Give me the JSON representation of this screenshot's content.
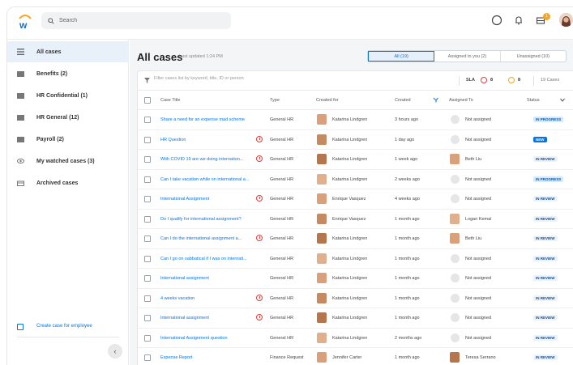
{
  "search": {
    "placeholder": "Search"
  },
  "header": {
    "notification_count": "1"
  },
  "sidebar": {
    "items": [
      {
        "label": "All cases",
        "icon": "list-icon",
        "active": true
      },
      {
        "label": "Benefits (2)",
        "icon": "folder-icon"
      },
      {
        "label": "HR Confidential (1)",
        "icon": "folder-icon"
      },
      {
        "label": "HR General (12)",
        "icon": "folder-icon"
      },
      {
        "label": "Payroll (2)",
        "icon": "folder-icon"
      },
      {
        "label": "My watched cases (3)",
        "icon": "eye-icon"
      },
      {
        "label": "Archived cases",
        "icon": "archive-icon"
      }
    ],
    "create_link": "Create case for employee"
  },
  "main": {
    "title": "All cases",
    "last_updated": "Last updated 1:24 PM",
    "tabs": [
      {
        "label": "All (19)",
        "active": true
      },
      {
        "label": "Assigned to you (2)"
      },
      {
        "label": "Unassigned (10)"
      }
    ],
    "filter_placeholder": "Filter cases list by keyword, title, ID or person",
    "sla_label": "SLA",
    "sla_red_count": "8",
    "sla_orange_count": "8",
    "case_count": "19 Cases",
    "columns": [
      "Case Title",
      "Type",
      "Created for",
      "Created",
      "Assigned To",
      "Status"
    ],
    "rows": [
      {
        "title": "Share a need for an expense mad scheme",
        "sla": false,
        "type": "General HR",
        "created_for": "Katarina Lindgren",
        "created": "3 hours ago",
        "assigned": "Not assigned",
        "status": "IN PROGRESS",
        "status_kind": "prog"
      },
      {
        "title": "HR Question",
        "sla": true,
        "type": "General HR",
        "created_for": "Katarina Lindgren",
        "created": "1 day ago",
        "assigned": "Not assigned",
        "status": "NEW",
        "status_kind": "new"
      },
      {
        "title": "With COVID 19 are we doing internation...",
        "sla": true,
        "type": "General HR",
        "created_for": "Katarina Lindgren",
        "created": "1 week ago",
        "assigned": "Beth Liu",
        "status": "IN REVIEW",
        "status_kind": "rev"
      },
      {
        "title": "Can I take vacation while on international a...",
        "sla": false,
        "type": "General HR",
        "created_for": "Katarina Lindgren",
        "created": "2 weeks ago",
        "assigned": "Not assigned",
        "status": "IN PROGRESS",
        "status_kind": "prog"
      },
      {
        "title": "International Assignment",
        "sla": true,
        "type": "General HR",
        "created_for": "Enrique Vasquez",
        "created": "4 weeks ago",
        "assigned": "Not assigned",
        "status": "IN REVIEW",
        "status_kind": "rev"
      },
      {
        "title": "Do I qualify for international assignment?",
        "sla": false,
        "type": "General HR",
        "created_for": "Enrique Vasquez",
        "created": "1 month ago",
        "assigned": "Logan Kemal",
        "status": "IN REVIEW",
        "status_kind": "rev"
      },
      {
        "title": "Can I do the international assignment a...",
        "sla": true,
        "type": "General HR",
        "created_for": "Katarina Lindgren",
        "created": "1 month ago",
        "assigned": "Beth Liu",
        "status": "IN REVIEW",
        "status_kind": "rev"
      },
      {
        "title": "Can I go on sabbatical if I was on internati...",
        "sla": false,
        "type": "General HR",
        "created_for": "Katarina Lindgren",
        "created": "1 month ago",
        "assigned": "Not assigned",
        "status": "IN REVIEW",
        "status_kind": "rev"
      },
      {
        "title": "International assignment",
        "sla": false,
        "type": "General HR",
        "created_for": "Katarina Lindgren",
        "created": "1 month ago",
        "assigned": "Not assigned",
        "status": "IN REVIEW",
        "status_kind": "rev"
      },
      {
        "title": "4 weeks vacation",
        "sla": true,
        "type": "General HR",
        "created_for": "Katarina Lindgren",
        "created": "1 month ago",
        "assigned": "Not assigned",
        "status": "IN REVIEW",
        "status_kind": "rev"
      },
      {
        "title": "International assignment",
        "sla": true,
        "type": "General HR",
        "created_for": "Katarina Lindgren",
        "created": "1 month ago",
        "assigned": "Not assigned",
        "status": "IN REVIEW",
        "status_kind": "rev"
      },
      {
        "title": "International Assignment question",
        "sla": false,
        "type": "General HR",
        "created_for": "Katarina Lindgren",
        "created": "2 months ago",
        "assigned": "Not assigned",
        "status": "IN REVIEW",
        "status_kind": "rev"
      },
      {
        "title": "Expense Report",
        "sla": false,
        "type": "Finance Request",
        "created_for": "Jennifer Carter",
        "created": "1 month ago",
        "assigned": "Teresa Serrano",
        "status": "IN REVIEW",
        "status_kind": "rev"
      }
    ]
  },
  "colors": {
    "accent": "#0875e1",
    "sla_red": "#e03c3c",
    "sla_orange": "#f5a623",
    "active_bg": "#e8f0fa"
  }
}
